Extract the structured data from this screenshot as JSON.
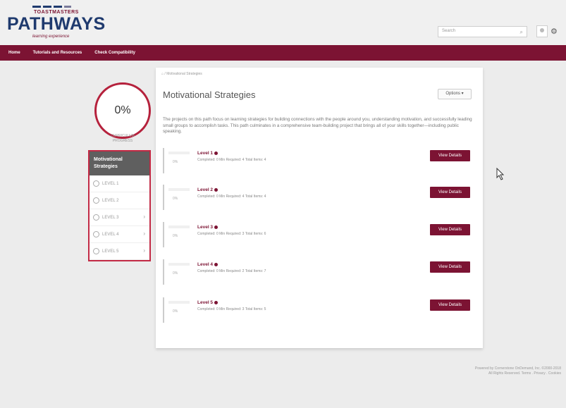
{
  "header": {
    "logo_top": "TOASTMASTERS",
    "logo_main": "PATHWAYS",
    "logo_sub": "learning experience",
    "search_placeholder": "Search"
  },
  "nav": {
    "items": [
      {
        "label": "Home"
      },
      {
        "label": "Tutorials and Resources"
      },
      {
        "label": "Check Compatibility"
      }
    ]
  },
  "progress": {
    "percent": "0%",
    "label_line1": "CURRICULUM",
    "label_line2": "PROGRESS"
  },
  "levels_panel": {
    "header": "Motivational Strategies",
    "items": [
      {
        "label": "LEVEL 1",
        "chevron": ""
      },
      {
        "label": "LEVEL 2",
        "chevron": ""
      },
      {
        "label": "LEVEL 3",
        "chevron": "›"
      },
      {
        "label": "LEVEL 4",
        "chevron": "›"
      },
      {
        "label": "LEVEL 5",
        "chevron": "›"
      }
    ]
  },
  "main": {
    "breadcrumb": "Motivational Strategies",
    "title": "Motivational Strategies",
    "options_label": "Options ▾",
    "description": "The projects on this path focus on learning strategies for building connections with the people around you, understanding motivation, and successfully leading small groups to accomplish tasks. This path culminates in a comprehensive team-building project that brings all of your skills together—including public speaking.",
    "levels": [
      {
        "title": "Level 1",
        "percent": "0%",
        "meta": "Completed: 0   Min Required: 4   Total Items: 4",
        "button": "View Details"
      },
      {
        "title": "Level 2",
        "percent": "0%",
        "meta": "Completed: 0   Min Required: 4   Total Items: 4",
        "button": "View Details"
      },
      {
        "title": "Level 3",
        "percent": "0%",
        "meta": "Completed: 0   Min Required: 3   Total Items: 6",
        "button": "View Details"
      },
      {
        "title": "Level 4",
        "percent": "0%",
        "meta": "Completed: 0   Min Required: 2   Total Items: 7",
        "button": "View Details"
      },
      {
        "title": "Level 5",
        "percent": "0%",
        "meta": "Completed: 0   Min Required: 3   Total Items: 5",
        "button": "View Details"
      }
    ]
  },
  "footer": {
    "line1": "Powered by Cornerstone OnDemand, Inc. ©2000-2018",
    "line2": "All Rights Reserved. Terms . Privacy . Cookies"
  },
  "colors": {
    "brand": "#7c1333",
    "accent": "#b5213c",
    "navy": "#1f3a6e"
  }
}
